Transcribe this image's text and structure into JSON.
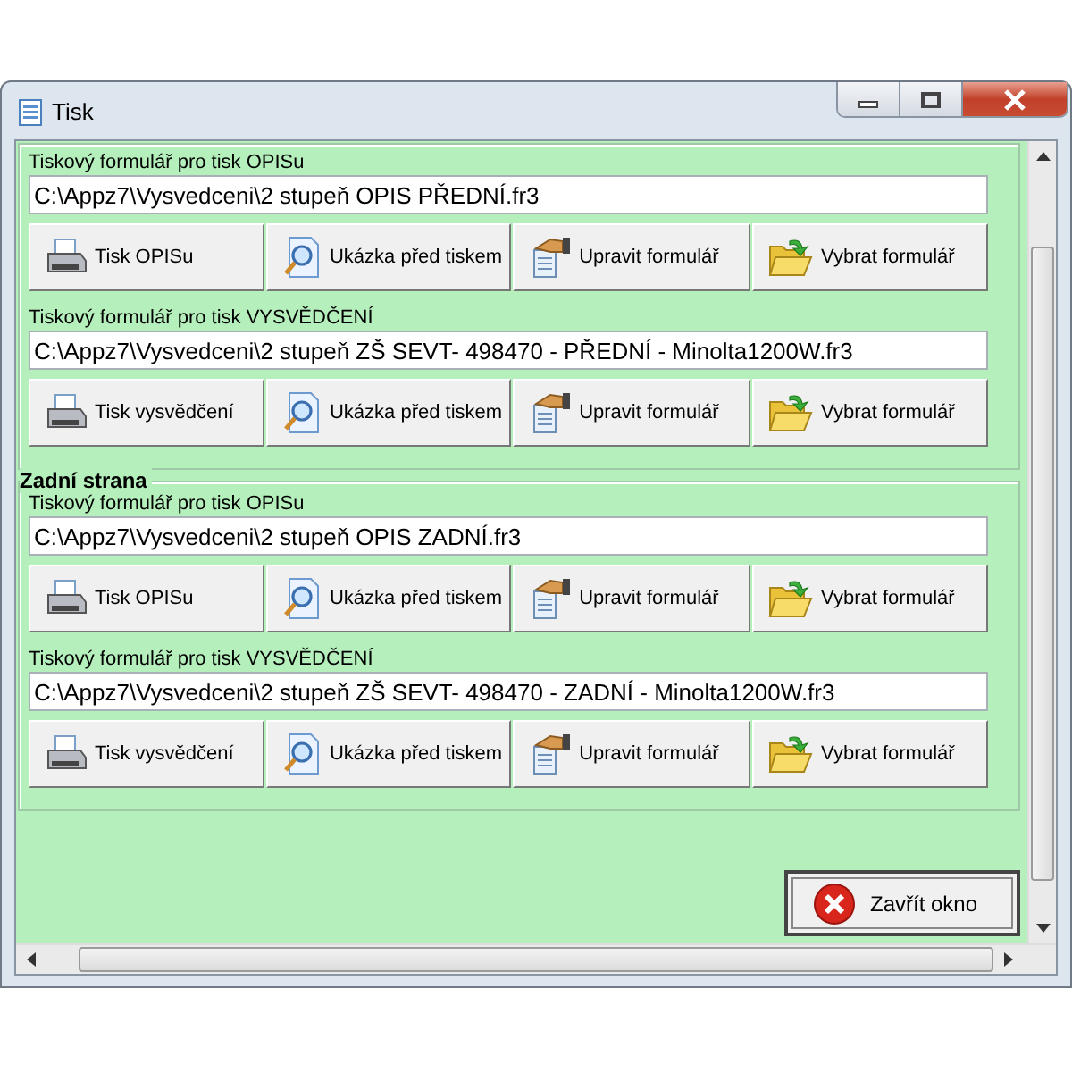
{
  "window": {
    "title": "Tisk"
  },
  "sections": [
    {
      "forms": [
        {
          "label": "Tiskový formulář pro tisk OPISu",
          "path": "C:\\Appz7\\Vysvedceni\\2 stupeň OPIS PŘEDNÍ.fr3",
          "buttons": [
            {
              "kind": "print",
              "label": "Tisk OPISu"
            },
            {
              "kind": "preview",
              "label": "Ukázka před tiskem"
            },
            {
              "kind": "edit",
              "label": "Upravit formulář"
            },
            {
              "kind": "choose",
              "label": "Vybrat formulář"
            }
          ]
        },
        {
          "label": "Tiskový formulář pro tisk VYSVĚDČENÍ",
          "path": "C:\\Appz7\\Vysvedceni\\2 stupeň ZŠ SEVT- 498470 - PŘEDNÍ - Minolta1200W.fr3",
          "buttons": [
            {
              "kind": "print",
              "label": "Tisk vysvědčení"
            },
            {
              "kind": "preview",
              "label": "Ukázka před tiskem"
            },
            {
              "kind": "edit",
              "label": "Upravit formulář"
            },
            {
              "kind": "choose",
              "label": "Vybrat formulář"
            }
          ]
        }
      ]
    },
    {
      "title": "Zadní strana",
      "forms": [
        {
          "label": "Tiskový formulář pro tisk OPISu",
          "path": "C:\\Appz7\\Vysvedceni\\2 stupeň OPIS ZADNÍ.fr3",
          "buttons": [
            {
              "kind": "print",
              "label": "Tisk OPISu"
            },
            {
              "kind": "preview",
              "label": "Ukázka před tiskem"
            },
            {
              "kind": "edit",
              "label": "Upravit formulář"
            },
            {
              "kind": "choose",
              "label": "Vybrat formulář"
            }
          ]
        },
        {
          "label": "Tiskový formulář pro tisk VYSVĚDČENÍ",
          "path": "C:\\Appz7\\Vysvedceni\\2 stupeň ZŠ SEVT- 498470 - ZADNÍ - Minolta1200W.fr3",
          "buttons": [
            {
              "kind": "print",
              "label": "Tisk vysvědčení"
            },
            {
              "kind": "preview",
              "label": "Ukázka před tiskem"
            },
            {
              "kind": "edit",
              "label": "Upravit formulář"
            },
            {
              "kind": "choose",
              "label": "Vybrat formulář"
            }
          ]
        }
      ]
    }
  ],
  "close_button": {
    "label": "Zavřít okno"
  }
}
